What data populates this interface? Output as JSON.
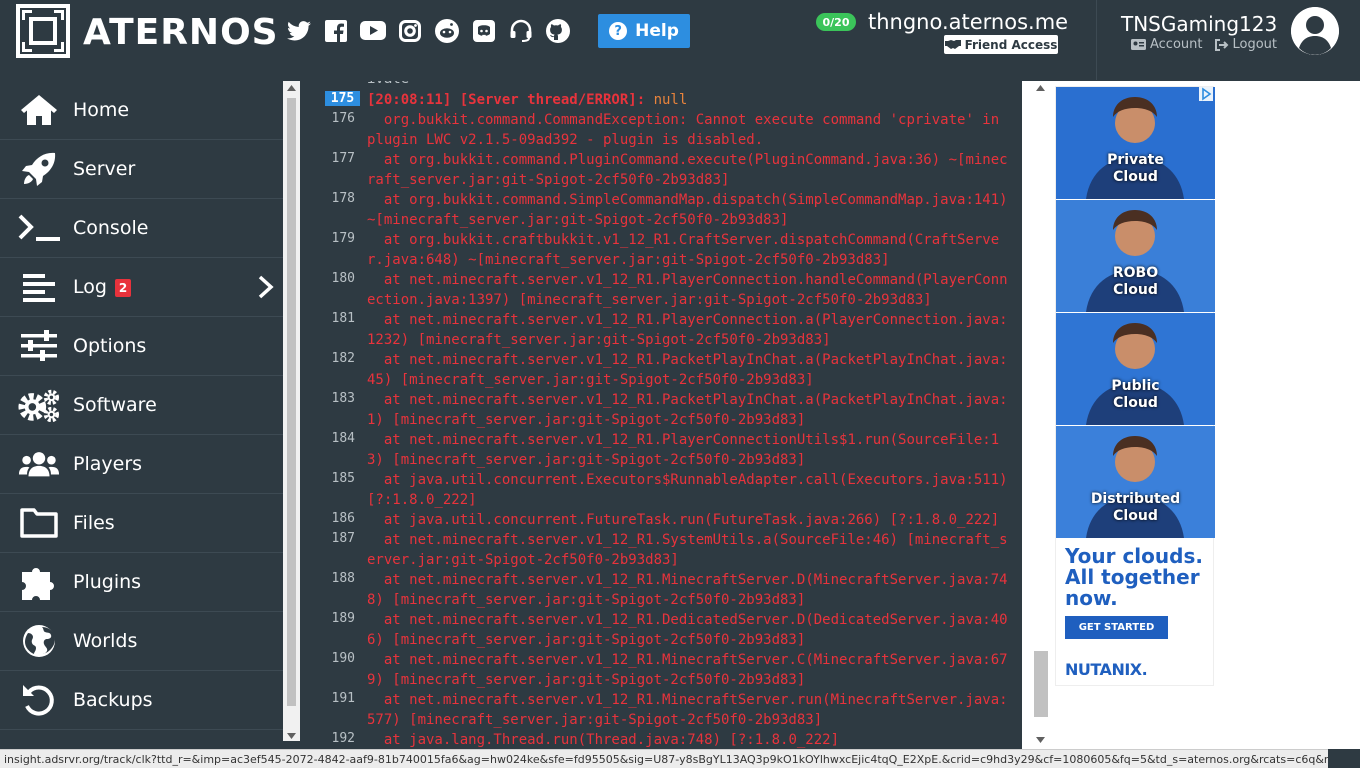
{
  "brand": {
    "name": "ATERNOS"
  },
  "header": {
    "socials": [
      "twitter-icon",
      "facebook-icon",
      "youtube-icon",
      "instagram-icon",
      "reddit-icon",
      "discord-icon",
      "support-icon",
      "github-icon"
    ],
    "help_label": "Help",
    "players_badge": "0/20",
    "server_address": "thngno.aternos.me",
    "friend_access_label": "Friend Access",
    "username": "TNSGaming123",
    "account_label": "Account",
    "logout_label": "Logout"
  },
  "sidebar": {
    "items": [
      {
        "label": "Home",
        "icon": "home-icon"
      },
      {
        "label": "Server",
        "icon": "rocket-icon"
      },
      {
        "label": "Console",
        "icon": "terminal-icon"
      },
      {
        "label": "Log",
        "icon": "log-icon",
        "badge": "2"
      },
      {
        "label": "Options",
        "icon": "sliders-icon"
      },
      {
        "label": "Software",
        "icon": "gears-icon"
      },
      {
        "label": "Players",
        "icon": "users-icon"
      },
      {
        "label": "Files",
        "icon": "folder-icon"
      },
      {
        "label": "Plugins",
        "icon": "puzzle-icon"
      },
      {
        "label": "Worlds",
        "icon": "globe-icon"
      },
      {
        "label": "Backups",
        "icon": "backup-icon"
      }
    ]
  },
  "console": {
    "partial_top": "ivate",
    "lines": [
      {
        "num": "175",
        "text": "[20:08:11] [Server thread/ERROR]: ",
        "suffix": "null",
        "highlight": true
      },
      {
        "num": "176",
        "text": "  org.bukkit.command.CommandException: Cannot execute command 'cprivate' in plugin LWC v2.1.5-09ad392 - plugin is disabled."
      },
      {
        "num": "177",
        "text": "  at org.bukkit.command.PluginCommand.execute(PluginCommand.java:36) ~[minecraft_server.jar:git-Spigot-2cf50f0-2b93d83]"
      },
      {
        "num": "178",
        "text": "  at org.bukkit.command.SimpleCommandMap.dispatch(SimpleCommandMap.java:141) ~[minecraft_server.jar:git-Spigot-2cf50f0-2b93d83]"
      },
      {
        "num": "179",
        "text": "  at org.bukkit.craftbukkit.v1_12_R1.CraftServer.dispatchCommand(CraftServer.java:648) ~[minecraft_server.jar:git-Spigot-2cf50f0-2b93d83]"
      },
      {
        "num": "180",
        "text": "  at net.minecraft.server.v1_12_R1.PlayerConnection.handleCommand(PlayerConnection.java:1397) [minecraft_server.jar:git-Spigot-2cf50f0-2b93d83]"
      },
      {
        "num": "181",
        "text": "  at net.minecraft.server.v1_12_R1.PlayerConnection.a(PlayerConnection.java:1232) [minecraft_server.jar:git-Spigot-2cf50f0-2b93d83]"
      },
      {
        "num": "182",
        "text": "  at net.minecraft.server.v1_12_R1.PacketPlayInChat.a(PacketPlayInChat.java:45) [minecraft_server.jar:git-Spigot-2cf50f0-2b93d83]"
      },
      {
        "num": "183",
        "text": "  at net.minecraft.server.v1_12_R1.PacketPlayInChat.a(PacketPlayInChat.java:1) [minecraft_server.jar:git-Spigot-2cf50f0-2b93d83]"
      },
      {
        "num": "184",
        "text": "  at net.minecraft.server.v1_12_R1.PlayerConnectionUtils$1.run(SourceFile:13) [minecraft_server.jar:git-Spigot-2cf50f0-2b93d83]"
      },
      {
        "num": "185",
        "text": "  at java.util.concurrent.Executors$RunnableAdapter.call(Executors.java:511) [?:1.8.0_222]"
      },
      {
        "num": "186",
        "text": "  at java.util.concurrent.FutureTask.run(FutureTask.java:266) [?:1.8.0_222]"
      },
      {
        "num": "187",
        "text": "  at net.minecraft.server.v1_12_R1.SystemUtils.a(SourceFile:46) [minecraft_server.jar:git-Spigot-2cf50f0-2b93d83]"
      },
      {
        "num": "188",
        "text": "  at net.minecraft.server.v1_12_R1.MinecraftServer.D(MinecraftServer.java:748) [minecraft_server.jar:git-Spigot-2cf50f0-2b93d83]"
      },
      {
        "num": "189",
        "text": "  at net.minecraft.server.v1_12_R1.DedicatedServer.D(DedicatedServer.java:406) [minecraft_server.jar:git-Spigot-2cf50f0-2b93d83]"
      },
      {
        "num": "190",
        "text": "  at net.minecraft.server.v1_12_R1.MinecraftServer.C(MinecraftServer.java:679) [minecraft_server.jar:git-Spigot-2cf50f0-2b93d83]"
      },
      {
        "num": "191",
        "text": "  at net.minecraft.server.v1_12_R1.MinecraftServer.run(MinecraftServer.java:577) [minecraft_server.jar:git-Spigot-2cf50f0-2b93d83]"
      },
      {
        "num": "192",
        "text": "  at java.lang.Thread.run(Thread.java:748) [?:1.8.0_222]"
      }
    ]
  },
  "ad": {
    "tiles": [
      {
        "caption_1": "Private",
        "caption_2": "Cloud",
        "color": "#2a6fd0"
      },
      {
        "caption_1": "ROBO",
        "caption_2": "Cloud",
        "color": "#3a7fd8"
      },
      {
        "caption_1": "Public",
        "caption_2": "Cloud",
        "color": "#2f75d4"
      },
      {
        "caption_1": "Distributed",
        "caption_2": "Cloud",
        "color": "#3b80da"
      }
    ],
    "headline": "Your clouds. All together now.",
    "cta": "GET STARTED",
    "brand": "NUTANIX."
  },
  "status_url": "insight.adsrvr.org/track/clk?ttd_r=&imp=ac3ef545-2072-4842-aaf9-81b740015fa6&ag=hw024ke&sfe=fd95505&sig=U87-y8sBgYL13AQ3p9kO1kOYlhwxcEjic4tqQ_E2XpE.&crid=c9hd3y29&cf=1080605&fq=5&td_s=aternos.org&rcats=c6q&mcat=g...",
  "colors": {
    "background": "#2e3a42",
    "accent": "#2d8ee0",
    "error": "#e8333c",
    "online": "#3bc45a"
  }
}
